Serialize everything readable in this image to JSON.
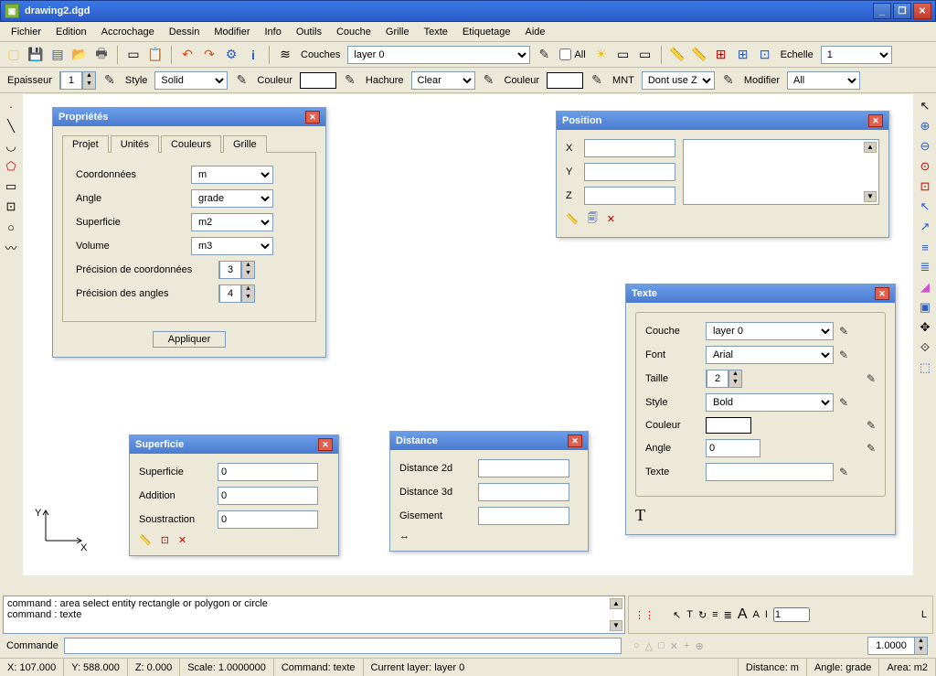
{
  "window": {
    "title": "drawing2.dgd"
  },
  "menu": [
    "Fichier",
    "Edition",
    "Accrochage",
    "Dessin",
    "Modifier",
    "Info",
    "Outils",
    "Couche",
    "Grille",
    "Texte",
    "Etiquetage",
    "Aide"
  ],
  "toolbar1": {
    "couches_label": "Couches",
    "couches_value": "layer 0",
    "all_label": "All",
    "echelle_label": "Echelle",
    "echelle_value": "1"
  },
  "toolbar2": {
    "epaisseur_label": "Epaisseur",
    "epaisseur_value": "1",
    "style_label": "Style",
    "style_value": "Solid",
    "couleur_label": "Couleur",
    "hachure_label": "Hachure",
    "hachure_value": "Clear",
    "couleur2_label": "Couleur",
    "mnt_label": "MNT",
    "mnt_value": "Dont use Z",
    "modifier_label": "Modifier",
    "modifier_value": "All"
  },
  "prop_dialog": {
    "title": "Propriétés",
    "tabs": [
      "Projet",
      "Unités",
      "Couleurs",
      "Grille"
    ],
    "active_tab": "Unités",
    "fields": {
      "coord_label": "Coordonnées",
      "coord_value": "m",
      "angle_label": "Angle",
      "angle_value": "grade",
      "surf_label": "Superficie",
      "surf_value": "m2",
      "vol_label": "Volume",
      "vol_value": "m3",
      "prec_coord_label": "Précision de coordonnées",
      "prec_coord_value": "3",
      "prec_angle_label": "Précision des angles",
      "prec_angle_value": "4"
    },
    "apply": "Appliquer"
  },
  "pos_dialog": {
    "title": "Position",
    "x_label": "X",
    "y_label": "Y",
    "z_label": "Z",
    "x_value": "",
    "y_value": "",
    "z_value": ""
  },
  "text_dialog": {
    "title": "Texte",
    "couche_label": "Couche",
    "couche_value": "layer 0",
    "font_label": "Font",
    "font_value": "Arial",
    "taille_label": "Taille",
    "taille_value": "2",
    "style_label": "Style",
    "style_value": "Bold",
    "couleur_label": "Couleur",
    "angle_label": "Angle",
    "angle_value": "0",
    "texte_label": "Texte",
    "texte_value": ""
  },
  "surf_dialog": {
    "title": "Superficie",
    "surf_label": "Superficie",
    "surf_value": "0",
    "add_label": "Addition",
    "add_value": "0",
    "sub_label": "Soustraction",
    "sub_value": "0"
  },
  "dist_dialog": {
    "title": "Distance",
    "d2_label": "Distance 2d",
    "d2_value": "",
    "d3_label": "Distance 3d",
    "d3_value": "",
    "gis_label": "Gisement",
    "gis_value": ""
  },
  "axis": {
    "y": "Y",
    "x": "X"
  },
  "command_log": {
    "line1": "command : area   select entity rectangle or polygon or circle",
    "line2": "command : texte"
  },
  "command_prompt": "Commande",
  "right_tools": {
    "value": "1",
    "value2": "1.0000"
  },
  "status": {
    "x": "X: 107.000",
    "y": "Y: 588.000",
    "z": "Z: 0.000",
    "scale": "Scale: 1.0000000",
    "cmd": "Command: texte",
    "layer": "Current layer: layer 0",
    "dist": "Distance: m",
    "angle": "Angle: grade",
    "area": "Area: m2"
  }
}
